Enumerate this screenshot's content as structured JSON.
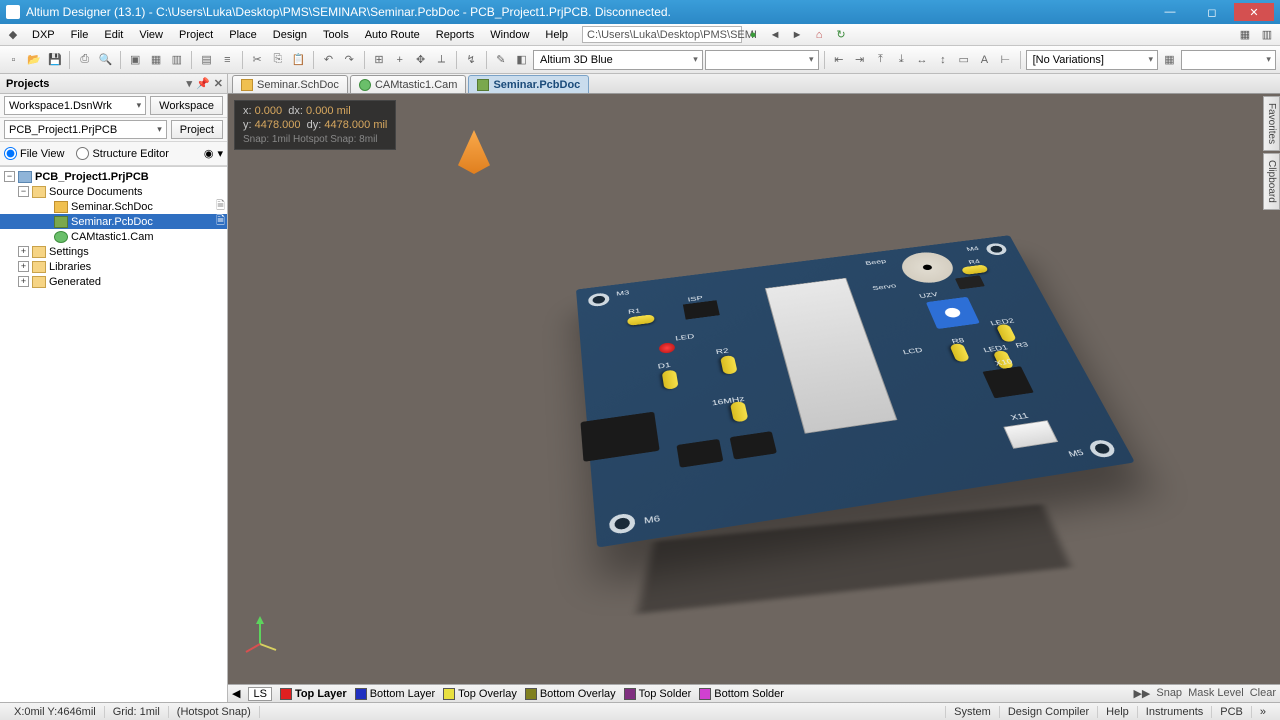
{
  "title": "Altium Designer (13.1) - C:\\Users\\Luka\\Desktop\\PMS\\SEMINAR\\Seminar.PcbDoc - PCB_Project1.PrjPCB. Disconnected.",
  "menu": {
    "dxp": "DXP",
    "file": "File",
    "edit": "Edit",
    "view": "View",
    "project": "Project",
    "place": "Place",
    "design": "Design",
    "tools": "Tools",
    "autoroute": "Auto Route",
    "reports": "Reports",
    "window": "Window",
    "help": "Help"
  },
  "addressbar": "C:\\Users\\Luka\\Desktop\\PMS\\SEMI",
  "toolbar": {
    "colorscheme": "Altium 3D Blue",
    "variations": "[No Variations]"
  },
  "projects": {
    "panel_title": "Projects",
    "workspace": "Workspace1.DsnWrk",
    "workspace_btn": "Workspace",
    "project": "PCB_Project1.PrjPCB",
    "project_btn": "Project",
    "fileview": "File View",
    "structure": "Structure Editor",
    "tree": {
      "root": "PCB_Project1.PrjPCB",
      "srcdocs": "Source Documents",
      "sch": "Seminar.SchDoc",
      "pcb": "Seminar.PcbDoc",
      "cam": "CAMtastic1.Cam",
      "settings": "Settings",
      "libraries": "Libraries",
      "generated": "Generated"
    }
  },
  "tabs": {
    "sch": "Seminar.SchDoc",
    "cam": "CAMtastic1.Cam",
    "pcb": "Seminar.PcbDoc"
  },
  "coords": {
    "x": "0.000",
    "dx": "0.000",
    "unit": "mil",
    "y": "4478.000",
    "dy": "4478.000",
    "snap": "Snap: 1mil Hotspot Snap: 8mil"
  },
  "board_labels": {
    "m3": "M3",
    "m4": "M4",
    "m5": "M5",
    "m6": "M6",
    "r1": "R1",
    "r2": "R2",
    "r3": "R3",
    "r4": "R4",
    "r8": "R8",
    "d1": "D1",
    "led": "LED",
    "led1": "LED1",
    "led2": "LED2",
    "isp": "ISP",
    "beep": "Beep",
    "servo": "Servo",
    "uzv": "UZV",
    "lcd": "LCD",
    "x10": "X10",
    "x11": "X11",
    "mhz": "16MHz"
  },
  "layers": {
    "ls": "LS",
    "top": "Top Layer",
    "bottom": "Bottom Layer",
    "topov": "Top Overlay",
    "botov": "Bottom Overlay",
    "topsold": "Top Solder",
    "botsold": "Bottom Solder",
    "snap": "Snap",
    "mask": "Mask Level",
    "clear": "Clear"
  },
  "sidetabs": {
    "fav": "Favorites",
    "clip": "Clipboard"
  },
  "status": {
    "coord": "X:0mil Y:4646mil",
    "grid": "Grid: 1mil",
    "hotspot": "(Hotspot Snap)",
    "system": "System",
    "compiler": "Design Compiler",
    "help": "Help",
    "instruments": "Instruments",
    "pcb": "PCB"
  }
}
